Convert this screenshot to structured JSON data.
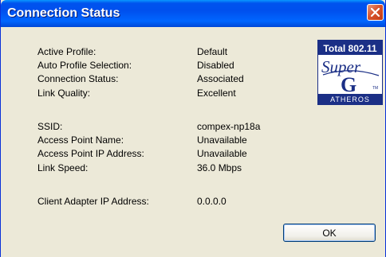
{
  "window": {
    "title": "Connection Status"
  },
  "fields": [
    {
      "label": "Active Profile:",
      "value": "Default"
    },
    {
      "label": "Auto Profile Selection:",
      "value": "Disabled"
    },
    {
      "label": "Connection Status:",
      "value": "Associated"
    },
    {
      "label": "Link Quality:",
      "value": "Excellent"
    },
    {
      "label": "SSID:",
      "value": "compex-np18a"
    },
    {
      "label": "Access Point Name:",
      "value": "Unavailable"
    },
    {
      "label": "Access Point IP Address:",
      "value": "Unavailable"
    },
    {
      "label": "Link Speed:",
      "value": "36.0 Mbps"
    },
    {
      "label": "Client Adapter IP Address:",
      "value": "0.0.0.0"
    }
  ],
  "logo": {
    "line1": "Total 802.11",
    "word": "Super",
    "letter": "G",
    "tm": "TM",
    "brand": "ATHEROS"
  },
  "buttons": {
    "ok_label": "OK"
  },
  "colors": {
    "titlebar": "#0053ee",
    "close": "#d8542e",
    "logo_blue": "#1b2f86",
    "face": "#ece9d8"
  },
  "icons": {
    "close": "close-icon"
  }
}
